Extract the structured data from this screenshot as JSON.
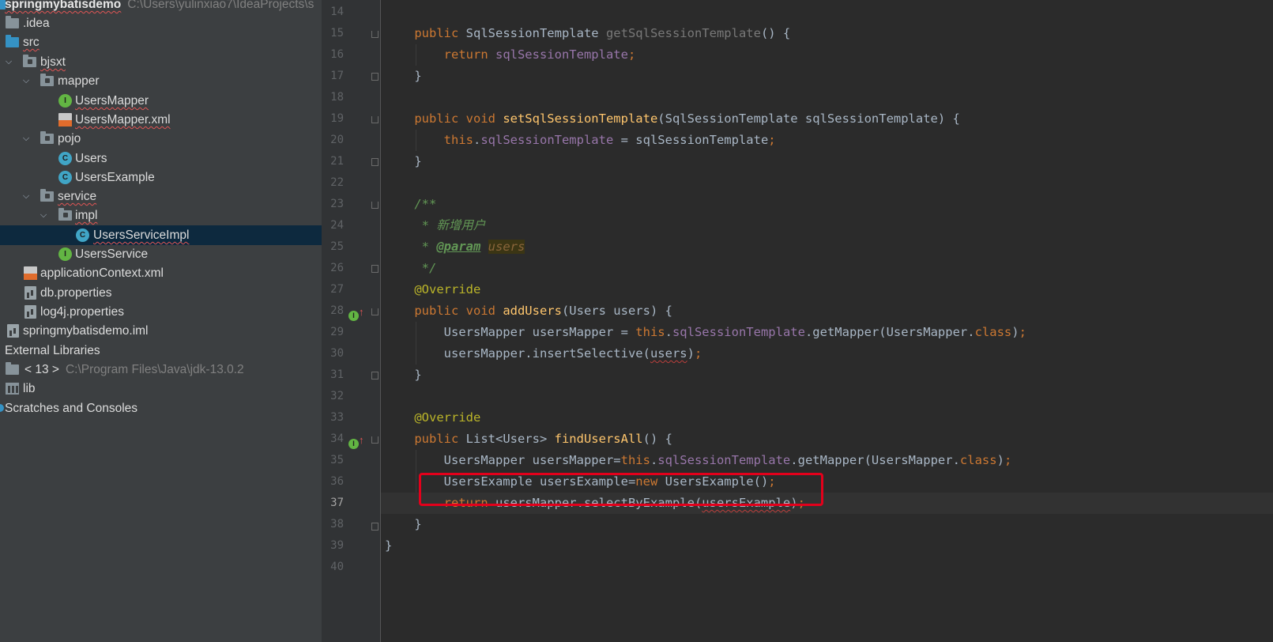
{
  "project_tree": {
    "root": {
      "label": "springmybatisdemo",
      "path": "C:\\Users\\yulinxiao7\\IdeaProjects\\s"
    },
    "items": [
      {
        "label": ".idea"
      },
      {
        "label": "src"
      },
      {
        "label": "bjsxt"
      },
      {
        "label": "mapper"
      },
      {
        "label": "UsersMapper"
      },
      {
        "label": "UsersMapper.xml"
      },
      {
        "label": "pojo"
      },
      {
        "label": "Users"
      },
      {
        "label": "UsersExample"
      },
      {
        "label": "service"
      },
      {
        "label": "impl"
      },
      {
        "label": "UsersServiceImpl"
      },
      {
        "label": "UsersService"
      },
      {
        "label": "applicationContext.xml"
      },
      {
        "label": "db.properties"
      },
      {
        "label": "log4j.properties"
      },
      {
        "label": "springmybatisdemo.iml"
      },
      {
        "label": "External Libraries"
      },
      {
        "label": "< 13 >",
        "path": "C:\\Program Files\\Java\\jdk-13.0.2"
      },
      {
        "label": "lib"
      },
      {
        "label": "Scratches and Consoles"
      }
    ],
    "selected": "UsersServiceImpl"
  },
  "editor": {
    "current_line": "37",
    "line_numbers": [
      "14",
      "15",
      "16",
      "17",
      "18",
      "19",
      "20",
      "21",
      "22",
      "23",
      "24",
      "25",
      "26",
      "27",
      "28",
      "29",
      "30",
      "31",
      "32",
      "33",
      "34",
      "35",
      "36",
      "37",
      "38",
      "39",
      "40"
    ],
    "code": {
      "l15": [
        "public ",
        "SqlSessionTemplate ",
        "getSqlSessionTemplate",
        "() {"
      ],
      "l16": [
        "return ",
        "sqlSessionTemplate",
        ";"
      ],
      "l17": [
        "}"
      ],
      "l19": [
        "public void ",
        "setSqlSessionTemplate",
        "(SqlSessionTemplate sqlSessionTemplate) {"
      ],
      "l20": [
        "this",
        ".",
        "sqlSessionTemplate",
        " = sqlSessionTemplate",
        ";"
      ],
      "l21": [
        "}"
      ],
      "l23": [
        "/**"
      ],
      "l24": [
        " * 新增用户"
      ],
      "l25": [
        " * ",
        "@param",
        " ",
        "users"
      ],
      "l26": [
        " */"
      ],
      "l27": [
        "@Override"
      ],
      "l28": [
        "public void ",
        "addUsers",
        "(Users users) {"
      ],
      "l29": [
        "UsersMapper usersMapper = ",
        "this",
        ".",
        "sqlSessionTemplate",
        ".getMapper(UsersMapper.",
        "class",
        ")",
        ";"
      ],
      "l30": [
        "usersMapper.insertSelective(",
        "users",
        ")",
        ";"
      ],
      "l31": [
        "}"
      ],
      "l33": [
        "@Override"
      ],
      "l34": [
        "public ",
        "List<Users> ",
        "findUsersAll",
        "() {"
      ],
      "l35": [
        "UsersMapper usersMapper=",
        "this",
        ".",
        "sqlSessionTemplate",
        ".getMapper(UsersMapper.",
        "class",
        ")",
        ";"
      ],
      "l36": [
        "UsersExample usersExample=",
        "new ",
        "UsersExample()",
        ";"
      ],
      "l37": [
        "return ",
        "usersMapper.selectByExample(",
        "usersExample",
        ")",
        ";"
      ],
      "l38": [
        "}"
      ],
      "l39": [
        "}"
      ]
    },
    "gutter_icons": [
      "override-icon",
      "override-icon"
    ],
    "highlight_color": "#e3001b"
  },
  "colors": {
    "sidebar_bg": "#3c3f41",
    "editor_bg": "#2b2b2b",
    "keyword": "#cc7832",
    "method": "#ffc66d",
    "field": "#9876aa",
    "annotation": "#bbb529",
    "comment": "#629755",
    "selection": "#0d293e"
  }
}
